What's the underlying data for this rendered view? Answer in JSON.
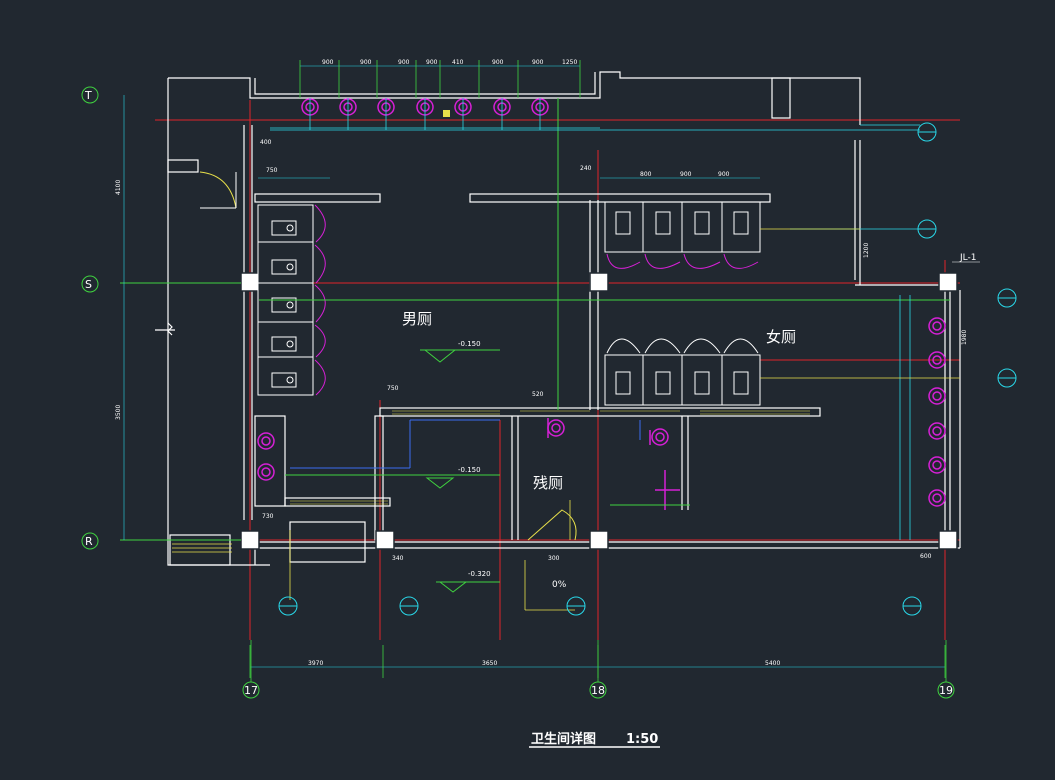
{
  "drawing": {
    "title": "卫生间详图",
    "scale": "1:50"
  },
  "colors": {
    "background": "#212830",
    "wall": "#ffffff",
    "red_line": "#e0232a",
    "green_line": "#3fd23f",
    "cyan_line": "#29d7e8",
    "blue_line": "#3a6df0",
    "yellow_line": "#e8e04a",
    "magenta_fixture": "#d620d6"
  },
  "rooms": {
    "mens": "男厕",
    "womens": "女厕",
    "accessible": "残厕"
  },
  "levels": {
    "mens_floor": "-0.150",
    "accessible_floor": "-0.150",
    "entry_floor": "-0.320",
    "ramp_slope": "0%"
  },
  "grid_axes": {
    "vertical": [
      "17",
      "18",
      "19"
    ],
    "horizontal": [
      "T",
      "S",
      "R"
    ]
  },
  "labels": {
    "riser": "JL-1"
  },
  "dimensions": {
    "top_fixture_spacing": [
      "900",
      "900",
      "900",
      "900",
      "410",
      "900",
      "900",
      "1250"
    ],
    "left_vertical": [
      "4100",
      "3500"
    ],
    "bottom_chain": [
      "3970",
      "3650",
      "5400"
    ],
    "misc": [
      "400",
      "750",
      "750",
      "520",
      "730",
      "800",
      "900",
      "900",
      "1980",
      "1200",
      "600",
      "240",
      "300",
      "340"
    ]
  }
}
